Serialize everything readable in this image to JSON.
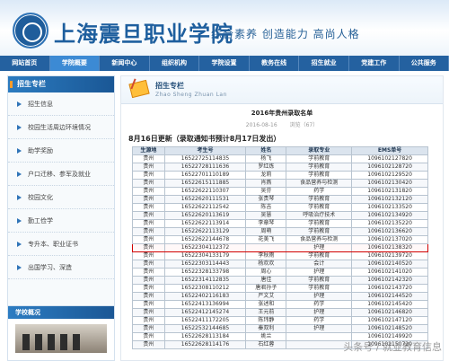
{
  "header": {
    "site_title": "上海震旦职业学院",
    "motto": "综合素养    创造能力    高尚人格"
  },
  "nav": [
    {
      "label": "网站首页",
      "active": false
    },
    {
      "label": "学院概要",
      "active": true
    },
    {
      "label": "新闻中心",
      "active": false
    },
    {
      "label": "组织机构",
      "active": false
    },
    {
      "label": "学院设置",
      "active": false
    },
    {
      "label": "教务在线",
      "active": false
    },
    {
      "label": "招生就业",
      "active": false
    },
    {
      "label": "党建工作",
      "active": false
    },
    {
      "label": "公共服务",
      "active": false
    }
  ],
  "sidebar": {
    "title": "招生专栏",
    "items": [
      {
        "label": "招生信息"
      },
      {
        "label": "校园生活周边环境情况"
      },
      {
        "label": "助学奖励"
      },
      {
        "label": "户口迁移、参军及就业"
      },
      {
        "label": "校园文化"
      },
      {
        "label": "勤工俭学"
      },
      {
        "label": "专升本、职业证书"
      },
      {
        "label": "出国学习、深造"
      }
    ]
  },
  "campus": {
    "title": "学校概况"
  },
  "content": {
    "section_title": "招生专栏",
    "section_pinyin": "Zhao Sheng Zhuan Lan",
    "article_title": "2016年贵州录取名单",
    "date": "2016-08-16",
    "views": "浏览（67）",
    "notice": "8月16日更新（录取通知书预计8月17日发出）"
  },
  "table": {
    "headers": [
      "生源地",
      "考生号",
      "姓名",
      "录取专业",
      "EMS单号"
    ],
    "rows": [
      [
        "贵州",
        "16522725114835",
        "杨飞",
        "学前教育",
        "1096102127820"
      ],
      [
        "贵州",
        "16522728111636",
        "罗红炼",
        "学前教育",
        "1096102128720"
      ],
      [
        "贵州",
        "16522701110189",
        "龙莉",
        "学前教育",
        "1096102129520"
      ],
      [
        "贵州",
        "16522615111885",
        "肖燕",
        "食品营养与检测",
        "1096102130420"
      ],
      [
        "贵州",
        "16522622110307",
        "吴芬",
        "药学",
        "1096102131820"
      ],
      [
        "贵州",
        "16522620111531",
        "张贵琴",
        "学前教育",
        "1096102132120"
      ],
      [
        "贵州",
        "16522622112542",
        "陈吉",
        "学前教育",
        "1096102133520"
      ],
      [
        "贵州",
        "16522620113619",
        "吴慧",
        "呼吸治疗技术",
        "1096102134920"
      ],
      [
        "贵州",
        "16522622113914",
        "李章琴",
        "学前教育",
        "1096102135220"
      ],
      [
        "贵州",
        "16522622113129",
        "周萌",
        "学前教育",
        "1096102136620"
      ],
      [
        "贵州",
        "16522622144678",
        "花美飞",
        "食品营养与检测",
        "1096102137020"
      ],
      [
        "贵州",
        "16522304112372",
        "",
        "护理",
        "1096102138320"
      ],
      [
        "贵州",
        "16522304133179",
        "李秋雨",
        "学前教育",
        "1096102139720"
      ],
      [
        "贵州",
        "16522303114443",
        "杨欢欢",
        "会计",
        "1096102140520"
      ],
      [
        "贵州",
        "16522328133798",
        "周心",
        "护理",
        "1096102141020"
      ],
      [
        "贵州",
        "16522314112835",
        "唐佳",
        "学前教育",
        "1096102142320"
      ],
      [
        "贵州",
        "16522308110212",
        "唐君孙子",
        "学前教育",
        "1096102143720"
      ],
      [
        "贵州",
        "16522402116183",
        "严文艾",
        "护理",
        "1096102144520"
      ],
      [
        "贵州",
        "16522413136994",
        "张述和",
        "药学",
        "1096102145420"
      ],
      [
        "贵州",
        "16522412145274",
        "王元前",
        "护理",
        "1096102146820"
      ],
      [
        "贵州",
        "16522411172205",
        "陈玮静",
        "药学",
        "1096102147120"
      ],
      [
        "贵州",
        "16522532144685",
        "秦双利",
        "护理",
        "1096102148520"
      ],
      [
        "贵州",
        "16522628113184",
        "姚兰",
        "",
        "1096102149920"
      ],
      [
        "贵州",
        "16522628114176",
        "石红蓉",
        "",
        "1096102150720"
      ]
    ],
    "highlight_row": 11
  },
  "watermark": "头条号 / 就业教育信息"
}
